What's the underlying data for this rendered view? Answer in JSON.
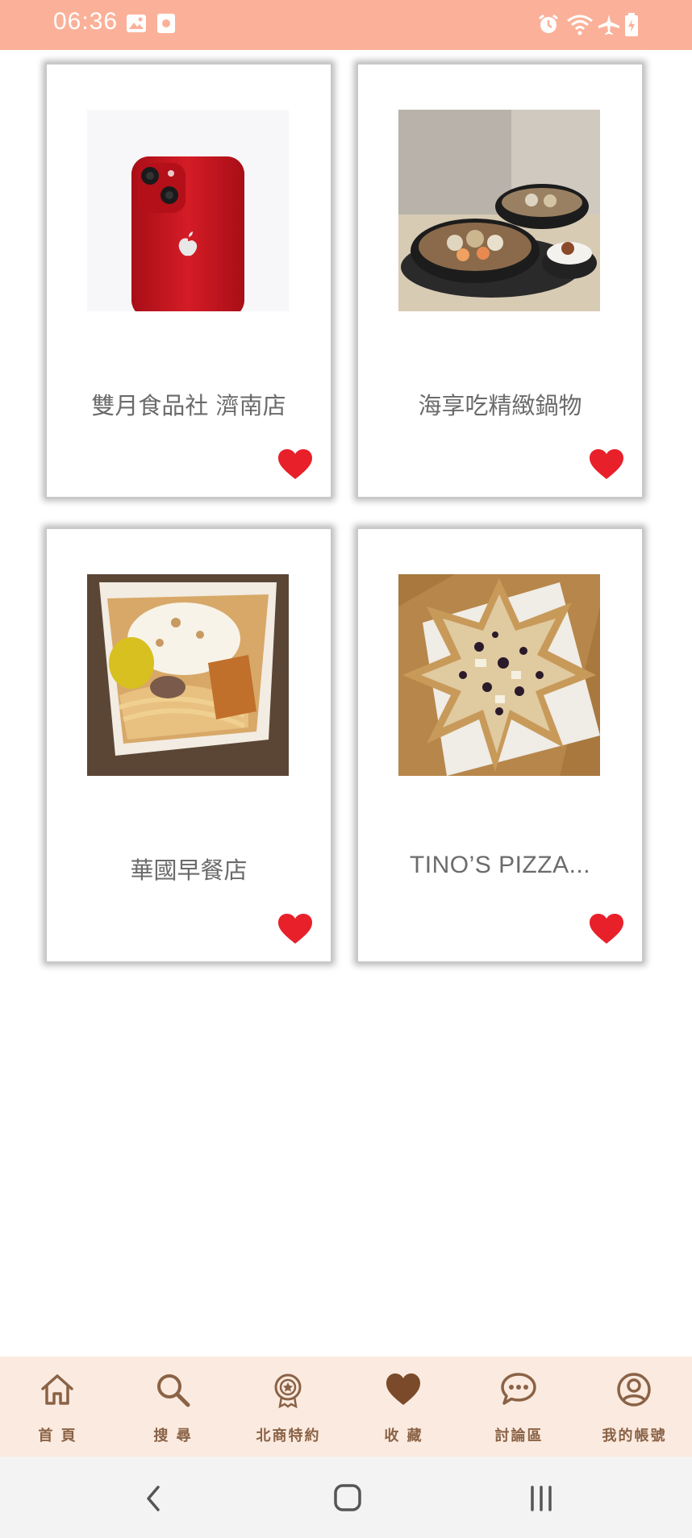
{
  "status_bar": {
    "time": "06:36",
    "color": "#fbb199",
    "icons": [
      "image-icon",
      "app-notification-icon",
      "alarm-icon",
      "wifi-icon",
      "airplane-icon",
      "battery-charging-icon"
    ]
  },
  "favorites": [
    {
      "title": "雙月食品社 濟南店",
      "image": "red-iphone-photo",
      "favorited": true
    },
    {
      "title": "海享吃精緻鍋物",
      "image": "hotpot-photo",
      "favorited": true
    },
    {
      "title": "華國早餐店",
      "image": "noodle-egg-box-photo",
      "favorited": true
    },
    {
      "title": "TINO’S PIZZA...",
      "image": "star-pizza-photo",
      "favorited": true
    }
  ],
  "bottom_nav": {
    "items": [
      {
        "label": "首 頁",
        "icon": "home-icon"
      },
      {
        "label": "搜 尋",
        "icon": "search-icon"
      },
      {
        "label": "北商特約",
        "icon": "badge-icon"
      },
      {
        "label": "收 藏",
        "icon": "heart-icon"
      },
      {
        "label": "討論區",
        "icon": "chat-icon"
      },
      {
        "label": "我的帳號",
        "icon": "account-icon"
      }
    ],
    "color": "#8a6246",
    "background": "#fbeadf"
  },
  "colors": {
    "heart": "#e8202a"
  }
}
